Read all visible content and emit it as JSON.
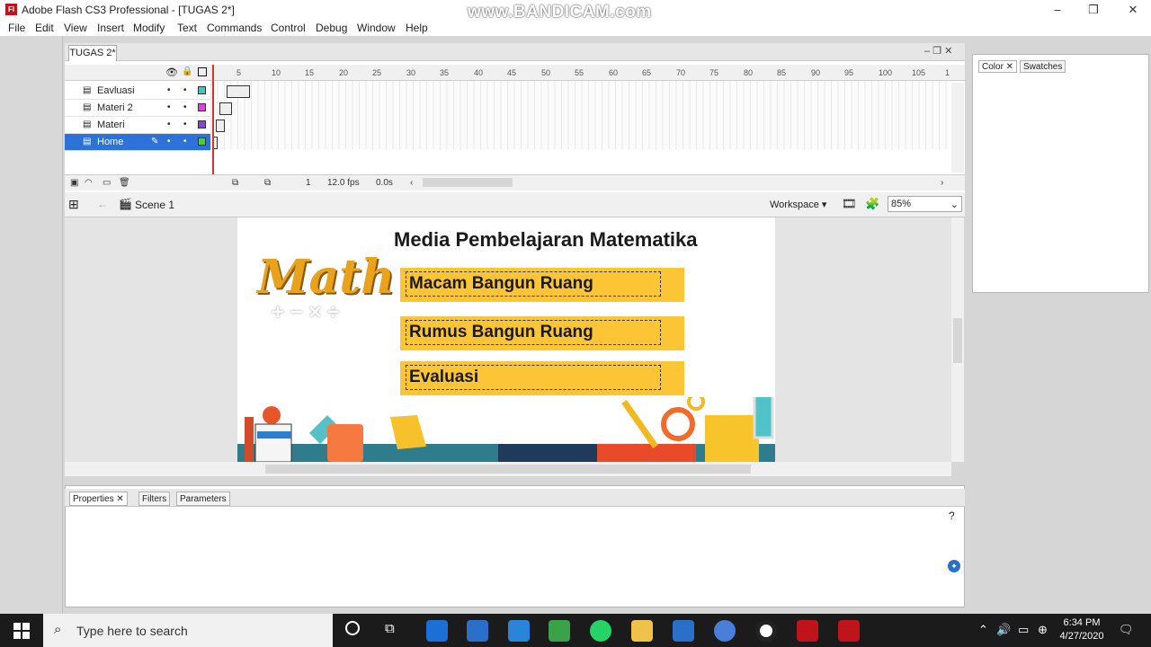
{
  "window": {
    "title": "Adobe Flash CS3 Professional - [TUGAS 2*]",
    "app_icon_text": "Fl",
    "watermark": "www.BANDICAM.com",
    "controls": [
      "–",
      "❐",
      "✕"
    ]
  },
  "menubar": [
    "File",
    "Edit",
    "View",
    "Insert",
    "Modify",
    "Text",
    "Commands",
    "Control",
    "Debug",
    "Window",
    "Help"
  ],
  "document": {
    "tab_label": "TUGAS 2*"
  },
  "timeline": {
    "ruler": [
      "5",
      "10",
      "15",
      "20",
      "25",
      "30",
      "35",
      "40",
      "45",
      "50",
      "55",
      "60",
      "65",
      "70",
      "75",
      "80",
      "85",
      "90",
      "95",
      "100",
      "105",
      "1"
    ],
    "layers": [
      {
        "name": "Eavluasi",
        "color": "#3fc7c7"
      },
      {
        "name": "Materi 2",
        "color": "#e040e0"
      },
      {
        "name": "Materi",
        "color": "#8a40e0"
      },
      {
        "name": "Home",
        "color": "#40d040"
      }
    ],
    "footer": {
      "frame": "1",
      "fps": "12.0 fps",
      "time": "0.0s"
    }
  },
  "scene": {
    "label": "Scene 1",
    "workspace": "Workspace ▾",
    "zoom": "85%"
  },
  "stage": {
    "title": "Media Pembelajaran Matematika",
    "logo_text": "Math",
    "logo_ops": "+ − × ÷",
    "buttons": [
      "Macam  Bangun Ruang",
      "Rumus Bangun Ruang",
      "Evaluasi"
    ]
  },
  "properties": {
    "tabs": [
      "Properties",
      "Filters",
      "Parameters"
    ]
  },
  "color_panel": {
    "tabs": [
      "Color",
      "Swatches"
    ]
  },
  "taskbar": {
    "search_placeholder": "Type here to search",
    "time": "6:34 PM",
    "date": "4/27/2020"
  },
  "colors": {
    "button_fill": "#fbc535",
    "selection": "#2d72d9",
    "taskbar": "#1b1b1b"
  }
}
